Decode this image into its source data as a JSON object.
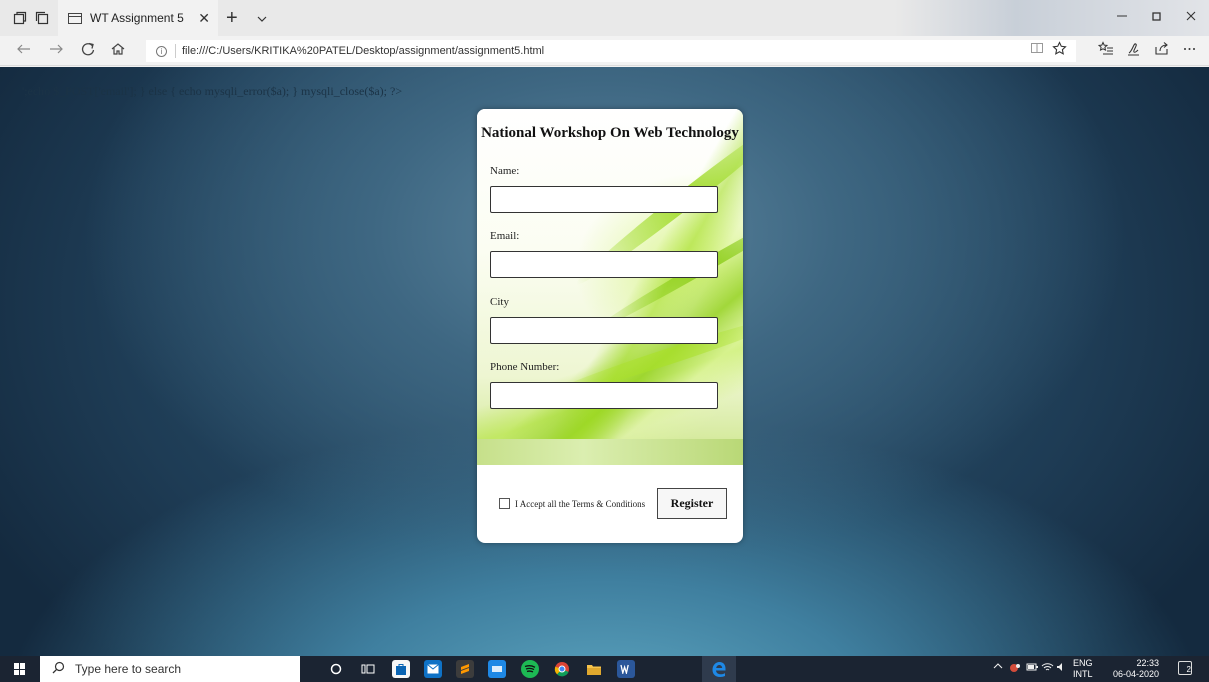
{
  "browser": {
    "tab_title": "WT Assignment 5",
    "tab_close": "✕",
    "new_tab": "+",
    "url": "file:///C:/Users/KRITIKA%20PATEL/Desktop/assignment/assignment5.html",
    "icons": [
      "tab-set-aside-icon",
      "tab-restore-icon",
      "tab-list-icon",
      "back-icon",
      "forward-icon",
      "refresh-icon",
      "home-icon",
      "info-icon",
      "reading-view-icon",
      "favorite-star-icon",
      "favorites-hub-icon",
      "web-note-icon",
      "share-icon",
      "more-icon",
      "minimize-icon",
      "maximize-icon",
      "close-icon"
    ]
  },
  "page": {
    "php_echo_text": "';echo $_POST['email']; } else { echo mysqli_error($a); } mysqli_close($a); ?>",
    "form": {
      "title": "National Workshop On Web Technology",
      "fields": [
        {
          "label": "Name:",
          "value": ""
        },
        {
          "label": "Email:",
          "value": ""
        },
        {
          "label": "City",
          "value": ""
        },
        {
          "label": "Phone Number:",
          "value": ""
        }
      ],
      "terms_label": "I Accept all the Terms & Conditions",
      "terms_checked": false,
      "register_label": "Register"
    }
  },
  "taskbar": {
    "search_placeholder": "Type here to search",
    "apps": [
      "cortana-icon",
      "task-view-icon",
      "store-icon",
      "mail-icon",
      "sublime-icon",
      "app-icon",
      "spotify-icon",
      "chrome-icon",
      "file-explorer-icon",
      "word-icon",
      "edge-icon"
    ],
    "lang_line1": "ENG",
    "lang_line2": "INTL",
    "time": "22:33",
    "date": "06-04-2020",
    "notification_count": "2"
  },
  "colors": {
    "accent_green": "#9fd62a",
    "page_bg_dark": "#1e3c55",
    "taskbar": "#1b2432"
  }
}
